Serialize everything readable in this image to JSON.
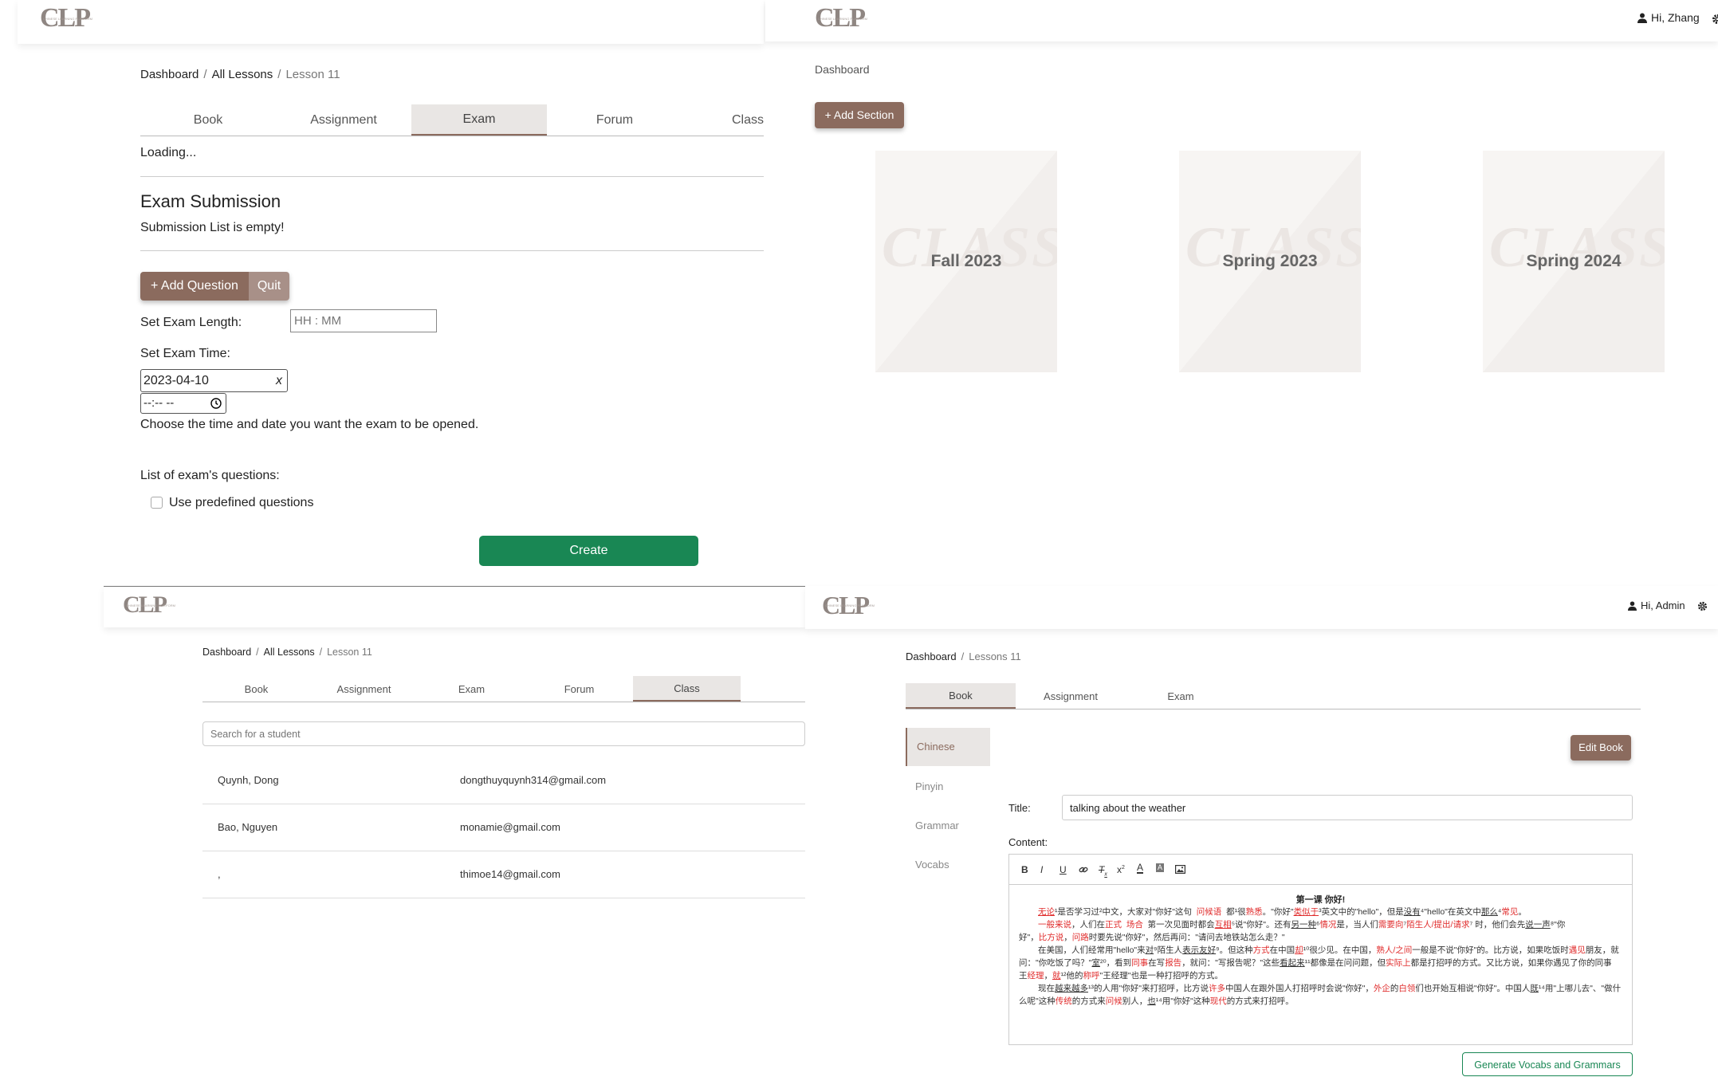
{
  "logo": {
    "text": "CLP",
    "tagline": "CHINESE LEARNING PLATFORM"
  },
  "panel_exam": {
    "breadcrumb": [
      "Dashboard",
      "All Lessons",
      "Lesson 11"
    ],
    "tabs": [
      "Book",
      "Assignment",
      "Exam",
      "Forum",
      "Class"
    ],
    "active_tab": "Exam",
    "loading": "Loading...",
    "section_title": "Exam Submission",
    "empty_message": "Submission List is empty!",
    "add_question": "+ Add Question",
    "quit": "Quit",
    "length_label": "Set Exam Length:",
    "length_placeholder": "HH : MM",
    "time_label": "Set Exam Time:",
    "date_value": "2023-04-10",
    "date_clear": "x",
    "time_value": "--:-- --",
    "time_hint": "Choose the time and date you want the exam to be opened.",
    "questions_label": "List of exam's questions:",
    "predefined_label": "Use predefined questions",
    "create_button": "Create"
  },
  "panel_dashboard": {
    "greeting": "Hi, Zhang",
    "breadcrumb": "Dashboard",
    "add_section": "+ Add Section",
    "watermark": "CLASS",
    "cards": [
      "Fall 2023",
      "Spring 2023",
      "Spring 2024"
    ]
  },
  "panel_class": {
    "breadcrumb": [
      "Dashboard",
      "All Lessons",
      "Lesson 11"
    ],
    "tabs": [
      "Book",
      "Assignment",
      "Exam",
      "Forum",
      "Class"
    ],
    "active_tab": "Class",
    "search_placeholder": "Search for a student",
    "students": [
      {
        "name": "Quynh, Dong",
        "email": "dongthuyquynh314@gmail.com"
      },
      {
        "name": "Bao, Nguyen",
        "email": "monamie@gmail.com"
      },
      {
        "name": ",",
        "email": "thimoe14@gmail.com"
      }
    ]
  },
  "panel_book": {
    "greeting": "Hi, Admin",
    "breadcrumb": [
      "Dashboard",
      "Lessons 11"
    ],
    "tabs": [
      "Book",
      "Assignment",
      "Exam"
    ],
    "active_tab": "Book",
    "side_items": [
      "Chinese",
      "Pinyin",
      "Grammar",
      "Vocabs"
    ],
    "edit_book": "Edit Book",
    "title_label": "Title:",
    "title_value": "talking about the weather",
    "content_label": "Content:",
    "toolbar": [
      "B",
      "I",
      "U",
      "link",
      "Tx",
      "x²",
      "A",
      "A",
      "img"
    ],
    "lesson_heading": "第一课 你好!",
    "generate_button": "Generate Vocabs and Grammars"
  }
}
